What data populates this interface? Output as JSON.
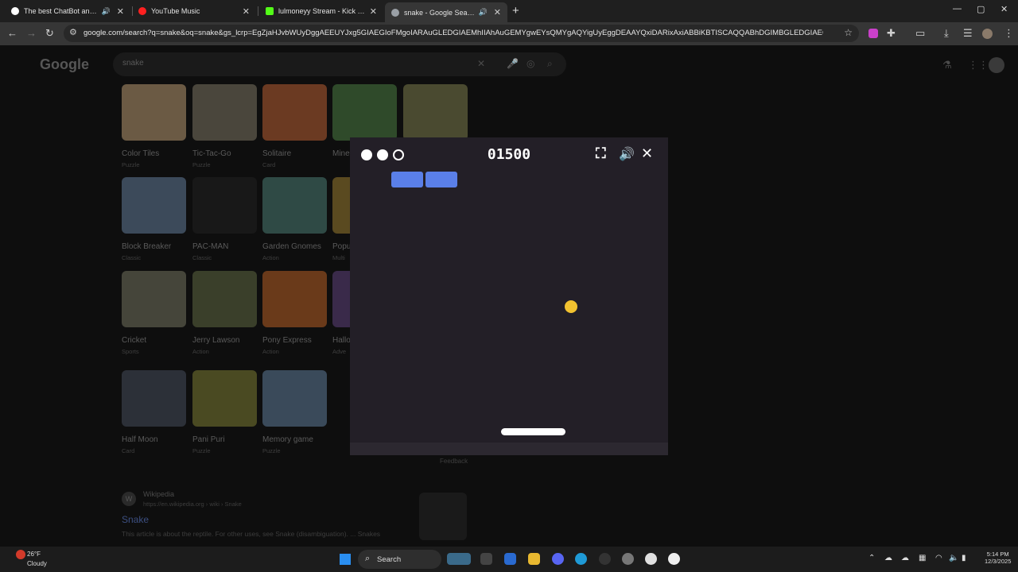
{
  "browser": {
    "tabs": [
      {
        "title": "The best ChatBot and Widg",
        "audio": "🔊",
        "active": false,
        "favicon_color": "#ffffff"
      },
      {
        "title": "YouTube Music",
        "audio": "",
        "active": false,
        "favicon_color": "#ff2020"
      },
      {
        "title": "lulmoneyy Stream - Kick Dashb",
        "audio": "",
        "active": false,
        "favicon_color": "#53fc18"
      },
      {
        "title": "snake - Google Search",
        "audio": "🔊",
        "active": true,
        "favicon_color": "#9aa0a6"
      }
    ],
    "new_tab": "+",
    "window_controls": {
      "minimize": "—",
      "maximize": "▢",
      "close": "✕"
    },
    "toolbar": {
      "back": "←",
      "forward": "→",
      "reload": "↻",
      "site_info_icon": "tune-icon",
      "url": "google.com/search?q=snake&oq=snake&gs_lcrp=EgZjaHJvbWUyDggAEEUYJxg5GIAEGIoFMgoIARAuGLEDGIAEMhIIAhAuGEMYgwEYsQMYgAQYigUyEggDEAAYQxiDARixAxiABBiKBTISCAQQABhDGIMBGLEDGIAEGIoFMg0IBRAAGI",
      "bookmark": "☆",
      "extensions": [
        "extension-u-icon",
        "puzzle-icon",
        "sidebar-icon",
        "download-icon",
        "reading-list-icon",
        "profile-avatar-icon",
        "menu-icon"
      ]
    }
  },
  "google": {
    "logo": "Google",
    "query": "snake",
    "header_icons": [
      "labs-icon",
      "apps-grid-icon",
      "account-avatar-icon"
    ],
    "games": [
      {
        "name": "Color Tiles",
        "category": "Puzzle",
        "color": "#6b5a44"
      },
      {
        "name": "Tic-Tac-Go",
        "category": "Puzzle",
        "color": "#4a463c"
      },
      {
        "name": "Solitaire",
        "category": "Card",
        "color": "#6b3a22"
      },
      {
        "name": "Mine",
        "category": "",
        "color": "#2f4a2a"
      },
      {
        "name": "",
        "category": "",
        "color": "#4a4a30"
      },
      {
        "name": "Block Breaker",
        "category": "Classic",
        "color": "#3c4a5a"
      },
      {
        "name": "PAC-MAN",
        "category": "Classic",
        "color": "#181818"
      },
      {
        "name": "Garden Gnomes",
        "category": "Action",
        "color": "#2f4a45"
      },
      {
        "name": "Popu",
        "category": "Multi",
        "color": "#5a4a20"
      },
      {
        "name": "Cricket",
        "category": "Sports",
        "color": "#45453a"
      },
      {
        "name": "Jerry Lawson",
        "category": "Action",
        "color": "#3a3f2a"
      },
      {
        "name": "Pony Express",
        "category": "Action",
        "color": "#6a3a1a"
      },
      {
        "name": "Hallo",
        "category": "Adve",
        "color": "#3a2a4a"
      },
      {
        "name": "Half Moon",
        "category": "Card",
        "color": "#2c3038"
      },
      {
        "name": "Pani Puri",
        "category": "Puzzle",
        "color": "#4a4a22"
      },
      {
        "name": "Memory game",
        "category": "Puzzle",
        "color": "#3a4a5a"
      }
    ],
    "feedback": "Feedback",
    "wiki": {
      "icon_letter": "W",
      "name": "Wikipedia",
      "url": "https://en.wikipedia.org › wiki › Snake",
      "title": "Snake",
      "snippet": "This article is about the reptile. For other uses, see Snake (disambiguation). ... Snakes"
    }
  },
  "game": {
    "score": "01500",
    "lives_total": 3,
    "lives_remaining": 2,
    "bricks_remaining": 2,
    "brick_color": "#5a7fe8",
    "ball_color": "#f2c230",
    "icons": {
      "fullscreen": "⛶",
      "sound": "🔊",
      "close": "✕"
    }
  },
  "taskbar": {
    "weather_temp": "26°F",
    "weather_desc": "Cloudy",
    "search_label": "Search",
    "apps": [
      "copilot-icon",
      "file-explorer-icon",
      "store-icon",
      "folder-icon",
      "discord-icon",
      "edge-icon",
      "app-icon",
      "settings-icon",
      "chrome-icon",
      "media-icon"
    ],
    "tray": [
      "chevron-up-icon",
      "cloud-sync-icon",
      "onedrive-icon",
      "network-icon",
      "wifi-icon",
      "volume-icon",
      "battery-icon"
    ],
    "time": "5:14 PM",
    "date": "12/3/2025"
  }
}
